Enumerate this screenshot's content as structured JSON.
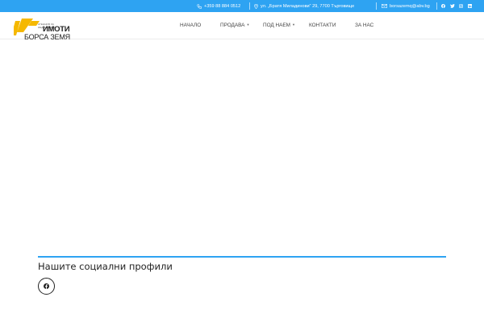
{
  "colors": {
    "accent": "#2ea3f2",
    "logo_yellow": "#f5b800"
  },
  "topbar": {
    "phone": "+359 88 884 0512",
    "address": "ул. „Братя Миладинови“ 29, 7700 Търговище",
    "email": "borsazemq@abv.bg",
    "social_icons": [
      "facebook-icon",
      "twitter-icon",
      "instagram-icon",
      "linkedin-icon"
    ]
  },
  "logo": {
    "small_text": "АГЕНЦИЯ ЗА НЕДВИЖИМИ",
    "line1": "ИМОТИ",
    "line2": "БОРСА ЗЕМЯ"
  },
  "nav": {
    "items": [
      {
        "label": "НАЧАЛО",
        "has_dropdown": false
      },
      {
        "label": "ПРОДАВА",
        "has_dropdown": true
      },
      {
        "label": "ПОД НАЕМ",
        "has_dropdown": true
      },
      {
        "label": "КОНТАКТИ",
        "has_dropdown": false
      },
      {
        "label": "ЗА НАС",
        "has_dropdown": false
      }
    ]
  },
  "social_section": {
    "title": "Нашите социални профили",
    "icons": [
      "facebook-icon"
    ]
  }
}
